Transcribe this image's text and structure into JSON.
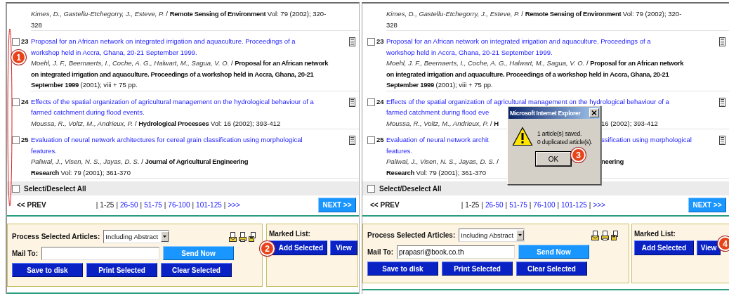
{
  "panels": [
    {
      "partial_record": {
        "lines": [
          {
            "text": "*Kimes, D., Gastellu-Etchegorry, J., Esteve, P.* / **Remote Sensing of Environment** Vol: 79 (2002); 320-"
          },
          {
            "text": "328"
          }
        ]
      },
      "records": [
        {
          "number": "23",
          "checked": false,
          "title_lines": [
            {
              "text": "Proposal for an African network on integrated irrigation and aquaculture. Proceedings of a"
            },
            {
              "text": "workshop held in Accra, Ghana, 20-21 September 1999."
            }
          ],
          "meta_lines": [
            {
              "text": "*Moehl, J. F., Beernaerts, I., Coche, A. G., Halwart, M., Sagua, V. O.* / **Proposal for an African network**"
            },
            {
              "text": "**on integrated irrigation and aquaculture. Proceedings of a workshop held in Accra, Ghana, 20-21**"
            },
            {
              "text": "**September 1999** (2001); viii + 75 pp."
            }
          ]
        },
        {
          "number": "24",
          "checked": false,
          "title_lines": [
            {
              "text": "Effects of the spatial organization of agricultural management on the hydrological behaviour of a"
            },
            {
              "text": "farmed catchment during flood events."
            }
          ],
          "meta_lines": [
            {
              "text": "*Moussa, R., Voltz, M., Andrieux, P.* / **Hydrological Processes** Vol: 16 (2002); 393-412"
            }
          ]
        },
        {
          "number": "25",
          "checked": false,
          "title_lines": [
            {
              "text": "Evaluation of neural network architectures for cereal grain classification using morphological"
            },
            {
              "text": "features."
            }
          ],
          "meta_lines": [
            {
              "text": "*Paliwal, J., Visen, N. S., Jayas, D. S.* / **Journal of Agricultural Engineering**"
            },
            {
              "text": "**Research** Vol: 79 (2001); 361-370"
            }
          ]
        }
      ],
      "select_all": {
        "label": "Select/Deselect All",
        "checked": false
      },
      "pagination": {
        "prev": "<< PREV",
        "items": [
          {
            "kind": "separator",
            "text": "|"
          },
          {
            "kind": "page",
            "text": "1-25",
            "selected": true
          },
          {
            "kind": "separator",
            "text": "|"
          },
          {
            "kind": "page",
            "text": "26-50",
            "selected": false
          },
          {
            "kind": "separator",
            "text": "|"
          },
          {
            "kind": "page",
            "text": "51-75",
            "selected": false
          },
          {
            "kind": "separator",
            "text": "|"
          },
          {
            "kind": "page",
            "text": "76-100",
            "selected": false
          },
          {
            "kind": "separator",
            "text": "|"
          },
          {
            "kind": "page",
            "text": "101-125",
            "selected": false
          },
          {
            "kind": "separator",
            "text": "|"
          },
          {
            "kind": "page",
            "text": ">>>",
            "selected": false
          }
        ],
        "next": {
          "label": "NEXT >>",
          "kind": "accent"
        }
      },
      "process": {
        "label": "Process Selected Articles:",
        "format": "Including Abstract",
        "mail_label": "Mail To:",
        "send": {
          "label": "Send Now",
          "kind": "accent"
        },
        "buttons": [
          {
            "label": "Save to disk",
            "kind": "primary"
          },
          {
            "label": "Print Selected",
            "kind": "primary"
          },
          {
            "label": "Clear Selected",
            "kind": "primary"
          }
        ]
      },
      "marked": {
        "label": "Marked List:",
        "buttons": [
          {
            "label": "Add Selected",
            "kind": "primary",
            "badge": "2"
          },
          {
            "label": "View",
            "kind": "primary"
          }
        ]
      },
      "callout": {
        "label": "1"
      }
    },
    {
      "partial_record": {
        "lines": [
          {
            "text": "*Kimes, D., Gastellu-Etchegorry, J., Esteve, P.* / **Remote Sensing of Environment** Vol: 79 (2002); 320-"
          },
          {
            "text": "328"
          }
        ]
      },
      "records": [
        {
          "number": "23",
          "checked": false,
          "title_lines": [
            {
              "text": "Proposal for an African network on integrated irrigation and aquaculture. Proceedings of a"
            },
            {
              "text": "workshop held in Accra, Ghana, 20-21 September 1999."
            }
          ],
          "meta_lines": [
            {
              "text": "*Moehl, J. F., Beernaerts, I., Coche, A. G., Halwart, M., Sagua, V. O.* / **Proposal for an African network**"
            },
            {
              "text": "**on integrated irrigation and aquaculture. Proceedings of a workshop held in Accra, Ghana, 20-21**"
            },
            {
              "text": "**September 1999** (2001); viii + 75 pp."
            }
          ]
        },
        {
          "number": "24",
          "checked": false,
          "title_lines": [
            {
              "text": "Effects of the spatial organization of agricultural management on the hydrological behaviour of a"
            },
            {
              "text": "farmed catchment during flood eve"
            }
          ],
          "meta_lines": [
            {
              "text": "*Moussa, R., Voltz, M., Andrieux, P.* / **H**",
              "after": "16 (2002); 393-412"
            }
          ]
        },
        {
          "number": "25",
          "checked": false,
          "title_lines": [
            {
              "text": "Evaluation of neural network archit",
              "after": "ssification using morphological"
            },
            {
              "text": "features."
            }
          ],
          "meta_lines": [
            {
              "text": "*Paliwal, J., Visen, N. S., Jayas, D. S.* /",
              "after": "**neering**"
            },
            {
              "text": "**Research** Vol: 79 (2001); 361-370"
            }
          ]
        }
      ],
      "select_all": {
        "label": "Select/Deselect All",
        "checked": false
      },
      "pagination": {
        "prev": "<< PREV",
        "items": [
          {
            "kind": "separator",
            "text": "|"
          },
          {
            "kind": "page",
            "text": "1-25",
            "selected": true
          },
          {
            "kind": "separator",
            "text": "|"
          },
          {
            "kind": "page",
            "text": "26-50",
            "selected": false
          },
          {
            "kind": "separator",
            "text": "|"
          },
          {
            "kind": "page",
            "text": "51-75",
            "selected": false
          },
          {
            "kind": "separator",
            "text": "|"
          },
          {
            "kind": "page",
            "text": "76-100",
            "selected": false
          },
          {
            "kind": "separator",
            "text": "|"
          },
          {
            "kind": "page",
            "text": "101-125",
            "selected": false
          },
          {
            "kind": "separator",
            "text": "|"
          },
          {
            "kind": "page",
            "text": ">>>",
            "selected": false
          }
        ],
        "next": {
          "label": "NEXT >>",
          "kind": "accent"
        }
      },
      "process": {
        "label": "Process Selected Articles:",
        "format": "Including Abstract",
        "mail_label": "Mail To:",
        "mail_value": "prapasri@book.co.th",
        "send": {
          "label": "Send Now",
          "kind": "accent"
        },
        "buttons": [
          {
            "label": "Save to disk",
            "kind": "primary"
          },
          {
            "label": "Print Selected",
            "kind": "primary"
          },
          {
            "label": "Clear Selected",
            "kind": "primary"
          }
        ]
      },
      "marked": {
        "label": "Marked List:",
        "buttons": [
          {
            "label": "Add Selected",
            "kind": "primary"
          },
          {
            "label": "View",
            "kind": "primary",
            "badge": "4"
          }
        ]
      }
    }
  ],
  "dialog": {
    "title": "Microsoft Internet Explorer",
    "messages": [
      "1 article(s) saved.",
      "0 duplicated article(s)."
    ],
    "button": {
      "label": "OK",
      "badge": "3"
    }
  }
}
